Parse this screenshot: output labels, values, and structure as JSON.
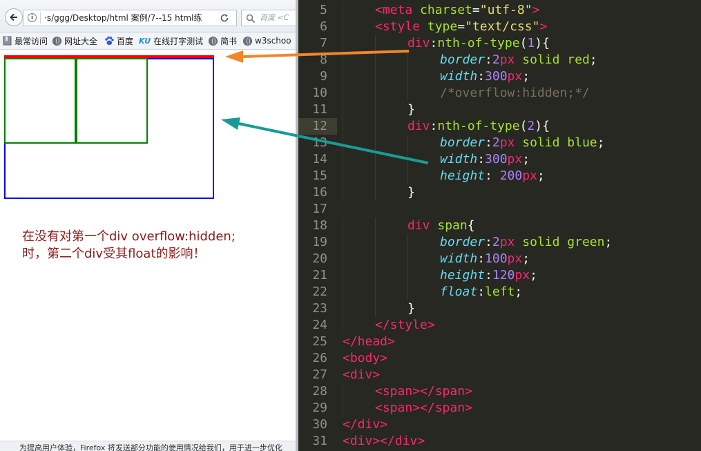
{
  "browser": {
    "url": "·s/ggg/Desktop/html 案例/7--15 html练",
    "search_placeholder": "百度 <C",
    "bookmarks": [
      {
        "label": "最常访问",
        "icon": "bookmark-folder-icon"
      },
      {
        "label": "网址大全",
        "icon": "globe-icon"
      },
      {
        "label": "百度",
        "icon": "baidu-paw-icon"
      },
      {
        "label": "在线打字测试",
        "icon": "ku-logo-icon",
        "icon_text": "KU"
      },
      {
        "label": "简书",
        "icon": "globe-icon"
      },
      {
        "label": "w3schoo",
        "icon": "globe-icon"
      }
    ],
    "note_line1": "在没有对第一个div  overflow:hidden;",
    "note_line2": "时，第二个div受其float的影响！",
    "status_text": "为提高用户体验，Firefox 将发送部分功能的使用情况给我们，用于进一步优化",
    "colors": {
      "box1_border": "#ff0000",
      "box2_border": "#0000ff",
      "span_border": "#008000",
      "note_text": "#8b1a1a"
    }
  },
  "editor": {
    "active_line": 12,
    "lines": [
      {
        "n": "5",
        "indent": 1,
        "tokens": [
          [
            "tag",
            "<meta "
          ],
          [
            "attr",
            "charset"
          ],
          [
            "plain",
            "="
          ],
          [
            "str",
            "\"utf-8\""
          ],
          [
            "tag",
            ">"
          ]
        ]
      },
      {
        "n": "6",
        "indent": 1,
        "tokens": [
          [
            "tag",
            "<style "
          ],
          [
            "attr",
            "type"
          ],
          [
            "plain",
            "="
          ],
          [
            "str",
            "\"text/css\""
          ],
          [
            "tag",
            ">"
          ]
        ]
      },
      {
        "n": "7",
        "indent": 2,
        "tokens": [
          [
            "tag",
            "div"
          ],
          [
            "plain",
            ":"
          ],
          [
            "attr",
            "nth-of-type"
          ],
          [
            "plain",
            "("
          ],
          [
            "num",
            "1"
          ],
          [
            "plain",
            "){"
          ]
        ]
      },
      {
        "n": "8",
        "indent": 3,
        "tokens": [
          [
            "prop",
            "border"
          ],
          [
            "plain",
            ":"
          ],
          [
            "num",
            "2"
          ],
          [
            "tag",
            "px"
          ],
          [
            "plain",
            " "
          ],
          [
            "attr",
            "solid red"
          ],
          [
            "plain",
            ";"
          ]
        ]
      },
      {
        "n": "9",
        "indent": 3,
        "tokens": [
          [
            "prop",
            "width"
          ],
          [
            "plain",
            ":"
          ],
          [
            "num",
            "300"
          ],
          [
            "tag",
            "px"
          ],
          [
            "plain",
            ";"
          ]
        ]
      },
      {
        "n": "10",
        "indent": 3,
        "tokens": [
          [
            "cmt",
            "/*overflow:hidden;*/"
          ]
        ]
      },
      {
        "n": "11",
        "indent": 2,
        "tokens": [
          [
            "plain",
            "}"
          ]
        ]
      },
      {
        "n": "12",
        "indent": 2,
        "tokens": [
          [
            "tag",
            "div"
          ],
          [
            "plain",
            ":"
          ],
          [
            "attr",
            "nth-of-type"
          ],
          [
            "plain",
            "("
          ],
          [
            "num",
            "2"
          ],
          [
            "plain",
            "){"
          ]
        ]
      },
      {
        "n": "13",
        "indent": 3,
        "tokens": [
          [
            "prop",
            "border"
          ],
          [
            "plain",
            ":"
          ],
          [
            "num",
            "2"
          ],
          [
            "tag",
            "px"
          ],
          [
            "plain",
            " "
          ],
          [
            "attr",
            "solid blue"
          ],
          [
            "plain",
            ";"
          ]
        ]
      },
      {
        "n": "14",
        "indent": 3,
        "tokens": [
          [
            "prop",
            "width"
          ],
          [
            "plain",
            ":"
          ],
          [
            "num",
            "300"
          ],
          [
            "tag",
            "px"
          ],
          [
            "plain",
            ";"
          ]
        ]
      },
      {
        "n": "15",
        "indent": 3,
        "tokens": [
          [
            "prop",
            "height"
          ],
          [
            "plain",
            ": "
          ],
          [
            "num",
            "200"
          ],
          [
            "tag",
            "px"
          ],
          [
            "plain",
            ";"
          ]
        ]
      },
      {
        "n": "16",
        "indent": 2,
        "tokens": [
          [
            "plain",
            "}"
          ]
        ]
      },
      {
        "n": "17",
        "indent": 0,
        "tokens": []
      },
      {
        "n": "18",
        "indent": 2,
        "tokens": [
          [
            "tag",
            "div "
          ],
          [
            "attr",
            "span"
          ],
          [
            "plain",
            "{"
          ]
        ]
      },
      {
        "n": "19",
        "indent": 3,
        "tokens": [
          [
            "prop",
            "border"
          ],
          [
            "plain",
            ":"
          ],
          [
            "num",
            "2"
          ],
          [
            "tag",
            "px"
          ],
          [
            "plain",
            " "
          ],
          [
            "attr",
            "solid green"
          ],
          [
            "plain",
            ";"
          ]
        ]
      },
      {
        "n": "20",
        "indent": 3,
        "tokens": [
          [
            "prop",
            "width"
          ],
          [
            "plain",
            ":"
          ],
          [
            "num",
            "100"
          ],
          [
            "tag",
            "px"
          ],
          [
            "plain",
            ";"
          ]
        ]
      },
      {
        "n": "21",
        "indent": 3,
        "tokens": [
          [
            "prop",
            "height"
          ],
          [
            "plain",
            ":"
          ],
          [
            "num",
            "120"
          ],
          [
            "tag",
            "px"
          ],
          [
            "plain",
            ";"
          ]
        ]
      },
      {
        "n": "22",
        "indent": 3,
        "tokens": [
          [
            "prop",
            "float"
          ],
          [
            "plain",
            ":"
          ],
          [
            "attr",
            "left"
          ],
          [
            "plain",
            ";"
          ]
        ]
      },
      {
        "n": "23",
        "indent": 2,
        "tokens": [
          [
            "plain",
            "}"
          ]
        ]
      },
      {
        "n": "24",
        "indent": 1,
        "tokens": [
          [
            "tag",
            "</style>"
          ]
        ]
      },
      {
        "n": "25",
        "indent": 0,
        "tokens": [
          [
            "tag",
            "</head>"
          ]
        ]
      },
      {
        "n": "26",
        "indent": 0,
        "tokens": [
          [
            "tag",
            "<body>"
          ]
        ]
      },
      {
        "n": "27",
        "indent": 0,
        "tokens": [
          [
            "tag",
            "<div>"
          ]
        ]
      },
      {
        "n": "28",
        "indent": 1,
        "tokens": [
          [
            "tag",
            "<span></span>"
          ]
        ]
      },
      {
        "n": "29",
        "indent": 1,
        "tokens": [
          [
            "tag",
            "<span></span>"
          ]
        ]
      },
      {
        "n": "30",
        "indent": 0,
        "tokens": [
          [
            "tag",
            "</div>"
          ]
        ]
      },
      {
        "n": "31",
        "indent": 0,
        "tokens": [
          [
            "tag",
            "<div></div>"
          ]
        ]
      }
    ],
    "colors": {
      "background": "#272822",
      "tag": "#f92672",
      "attr": "#a6e22e",
      "str": "#e6db74",
      "prop": "#66d9ef",
      "num": "#ae81ff",
      "comment": "#75715e"
    }
  },
  "arrows": [
    {
      "name": "arrow-orange",
      "color": "#f0862a"
    },
    {
      "name": "arrow-teal",
      "color": "#1a9a95"
    }
  ]
}
